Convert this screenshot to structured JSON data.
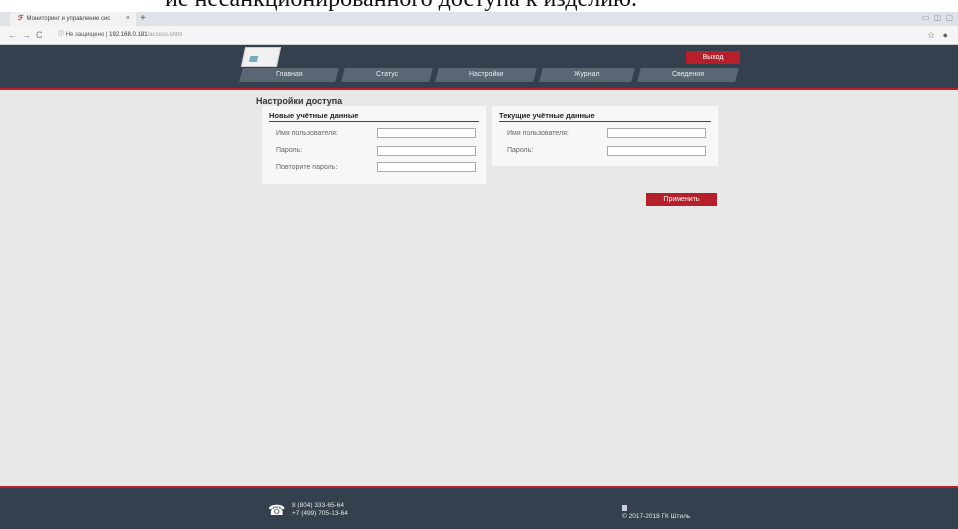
{
  "doc_caption": "ие несанкционированного доступа к изделию.",
  "browser": {
    "tab_title": "Мониторинг и управление сис",
    "tab_favicon": "logo-icon",
    "tab_close": "×",
    "new_tab": "+",
    "back": "←",
    "forward": "→",
    "reload": "C",
    "security_icon": "ⓘ",
    "security_text": "Не защищено",
    "url_host": "192.168.0.181",
    "url_path": "/access.shtm",
    "bookmark_icon": "☆",
    "account_icon": "👤"
  },
  "header": {
    "logout_label": "Выход",
    "nav": [
      {
        "label": "Главная"
      },
      {
        "label": "Статус"
      },
      {
        "label": "Настройки"
      },
      {
        "label": "Журнал"
      },
      {
        "label": "Сведения"
      }
    ]
  },
  "content": {
    "title": "Настройки доступа",
    "new_credentials": {
      "heading": "Новые учётные данные",
      "username_label": "Имя пользователя:",
      "password_label": "Пароль:",
      "repeat_password_label": "Повторите пароль:",
      "username_value": "",
      "password_value": "",
      "repeat_password_value": ""
    },
    "current_credentials": {
      "heading": "Текущие учётные данные",
      "username_label": "Имя пользователя:",
      "password_label": "Пароль:",
      "username_value": "",
      "password_value": ""
    },
    "apply_label": "Применить"
  },
  "footer": {
    "phone_icon": "☎",
    "phone_1": "8 (804) 333-65-64",
    "phone_2": "+7 (499) 705-13-64",
    "copyright": "© 2017-2018 ГК Штиль"
  },
  "colors": {
    "header_bg": "#34404e",
    "accent_red": "#b5202a",
    "nav_item_bg": "#5a6674",
    "page_bg": "#e8e8e8"
  }
}
